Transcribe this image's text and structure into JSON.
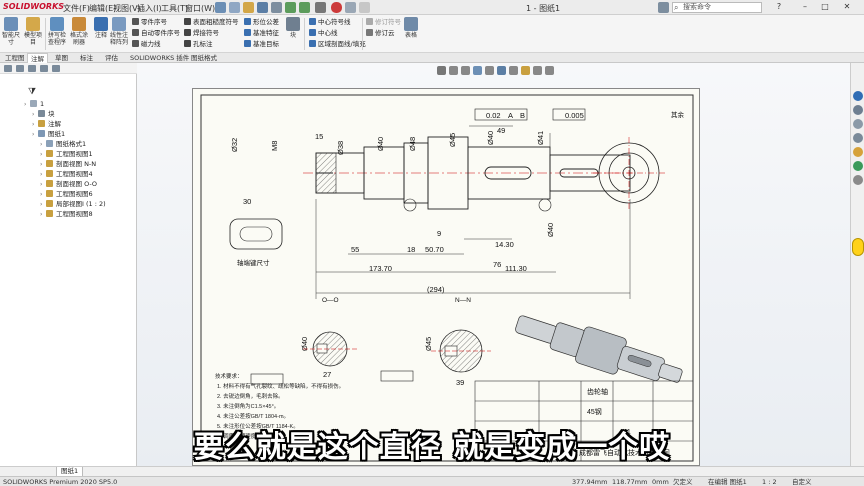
{
  "app": {
    "brand": "SOLIDWORKS",
    "doc_title": "1 - 图纸1",
    "search_placeholder": "搜索命令",
    "menus": [
      "文件(F)",
      "编辑(E)",
      "视图(V)",
      "插入(I)",
      "工具(T)",
      "窗口(W)"
    ],
    "window_controls": [
      "?",
      "–",
      "□",
      "✕"
    ]
  },
  "ribbon": {
    "big_buttons": [
      {
        "label": "智能尺寸"
      },
      {
        "label": "模型项目"
      },
      {
        "label": "拼写检查程序"
      },
      {
        "label": "格式涂刷器"
      },
      {
        "label": "注释"
      },
      {
        "label": "线性注释阵列"
      }
    ],
    "col1": [
      "零件序号",
      "自动零件序号",
      "磁力线"
    ],
    "col2": [
      "表面粗糙度符号",
      "焊接符号",
      "孔标注"
    ],
    "col3": [
      "形位公差",
      "基准特征",
      "基准目标"
    ],
    "block_label": "块",
    "col4": [
      "中心符号线",
      "中心线",
      "区域剖面线/填充"
    ],
    "col5": [
      "修订符号",
      "修订云"
    ],
    "table_label": "表格"
  },
  "tabs": [
    "工程图",
    "注解",
    "草图",
    "标注",
    "评估",
    "SOLIDWORKS 插件",
    "图纸格式"
  ],
  "active_tab": 1,
  "tree": [
    {
      "label": "1",
      "level": 0,
      "color": "#9aa8b8"
    },
    {
      "label": "块",
      "level": 1,
      "color": "#7a8a99"
    },
    {
      "label": "注解",
      "level": 1,
      "color": "#c8a040"
    },
    {
      "label": "图纸1",
      "level": 1,
      "color": "#7e98b5"
    },
    {
      "label": "图纸格式1",
      "level": 2,
      "color": "#8aa0b8"
    },
    {
      "label": "工程图视图1",
      "level": 2,
      "color": "#c8a040"
    },
    {
      "label": "剖面视图 N-N",
      "level": 2,
      "color": "#c8a040"
    },
    {
      "label": "工程图视图4",
      "level": 2,
      "color": "#c8a040"
    },
    {
      "label": "剖面视图 O-O",
      "level": 2,
      "color": "#c8a040"
    },
    {
      "label": "工程图视图6",
      "level": 2,
      "color": "#c8a040"
    },
    {
      "label": "局部视图I (1 : 2)",
      "level": 2,
      "color": "#c8a040"
    },
    {
      "label": "工程图视图8",
      "level": 2,
      "color": "#c8a040"
    }
  ],
  "drawing": {
    "dims": [
      "Ø32",
      "M8",
      "15",
      "Ø38",
      "Ø40",
      "Ø48",
      "Ø45",
      "Ø40",
      "49",
      "Ø41",
      "Ø40",
      "0.005",
      "0.02",
      "A",
      "B",
      "30",
      "55",
      "18",
      "50.70",
      "9",
      "14.30",
      "76",
      "173.70",
      "111.30",
      "(294)",
      "27",
      "39",
      "Ø40",
      "Ø45"
    ],
    "note_detail": "轴端键尺寸",
    "note_other": "其余",
    "section_labels": [
      "O—O",
      "N—N"
    ],
    "tech_title": "技术要求：",
    "tech_lines": [
      "1. 材料不得有气孔裂纹、疏松等缺陷，不得有损伤。",
      "2. 去锐边倒角，毛刺去除。",
      "3. 未注倒角为C1.5×45°。",
      "4. 未注公差按GB/T 1804-m。",
      "5. 未注形位公差按GB/T 1184-K。",
      "6. 调质处理硬度HB220-250。"
    ],
    "title_block": {
      "part_name": "齿轮轴",
      "material": "45钢",
      "company": "成都雷飞自动化技术有限公司",
      "scale": "1:1"
    }
  },
  "subtitle": "要么就是这个直径 就是变成一个哎",
  "sheet_tab": "图纸1",
  "status": {
    "product": "SOLIDWORKS Premium 2020 SP5.0",
    "x": "377.94mm",
    "y": "118.77mm",
    "z": "0mm",
    "state": "欠定义",
    "editing": "在编辑 图纸1",
    "scale": "1 : 2",
    "custom": "自定义"
  }
}
